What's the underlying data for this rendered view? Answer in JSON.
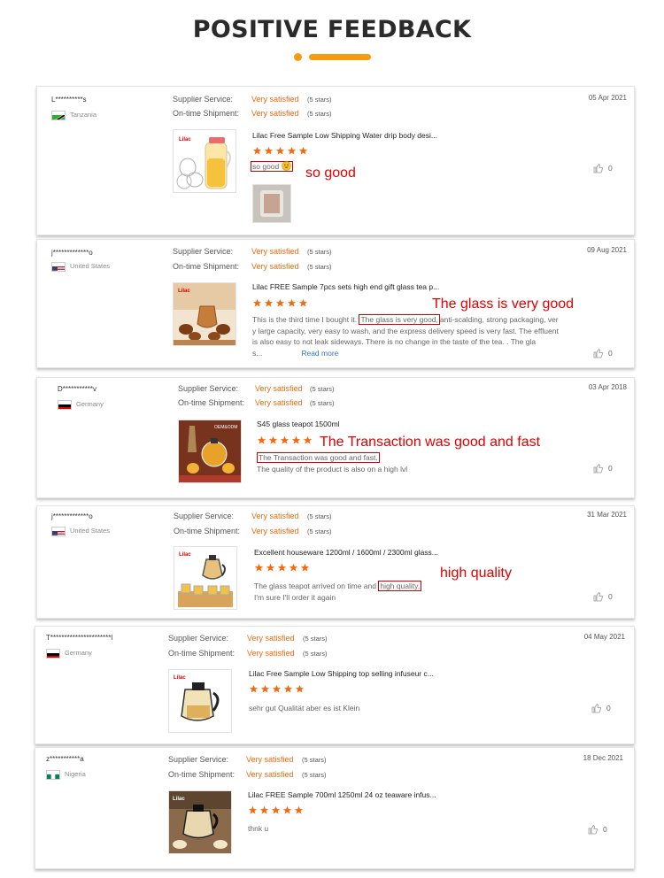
{
  "header": {
    "title": "POSITIVE FEEDBACK"
  },
  "labels": {
    "supplier_service": "Supplier Service:",
    "ontime_shipment": "On-time Shipment:"
  },
  "reviews": [
    {
      "user": "L**********s",
      "country": "Tanzania",
      "date": "05 Apr 2021",
      "supplier_rating": "Very satisfied",
      "supplier_stars": "(5 stars)",
      "shipment_rating": "Very satisfied",
      "shipment_stars": "(5 stars)",
      "product_title": "Lilac Free Sample Low Shipping Water drip body desi...",
      "review_highlight": "so good",
      "annotation": "so good",
      "likes": "0"
    },
    {
      "user": "j*************o",
      "country": "United States",
      "date": "09 Aug 2021",
      "supplier_rating": "Very satisfied",
      "supplier_stars": "(5 stars)",
      "shipment_rating": "Very satisfied",
      "shipment_stars": "(5 stars)",
      "product_title": "Lilac FREE Sample 7pcs sets high end gift glass tea p...",
      "review_before": "This is the third time I bought it.",
      "review_highlight": "The glass is very good,",
      "review_after": "anti-scalding, strong packaging, ver",
      "review_line2": "y large capacity, very easy to wash, and the express delivery speed is very fast. The effluent",
      "review_line3": "is also easy to not leak sideways. There is no change in the taste of the tea. . The gla",
      "review_line4": "s...",
      "read_more": "Read more",
      "annotation": "The glass is very good",
      "likes": "0"
    },
    {
      "user": "D***********v",
      "country": "Germany",
      "date": "03 Apr 2018",
      "supplier_rating": "Very satisfied",
      "supplier_stars": "(5 stars)",
      "shipment_rating": "Very satisfied",
      "shipment_stars": "(5 stars)",
      "product_title": "S45 glass teapot 1500ml",
      "review_highlight": "The Transaction was good and fast.",
      "review_line2": "The quality of the product is also on a high lvl",
      "annotation": "The Transaction was good and fast",
      "likes": "0"
    },
    {
      "user": "j*************o",
      "country": "United States",
      "date": "31 Mar 2021",
      "supplier_rating": "Very satisfied",
      "supplier_stars": "(5 stars)",
      "shipment_rating": "Very satisfied",
      "shipment_stars": "(5 stars)",
      "product_title": "Excellent houseware 1200ml / 1600ml / 2300ml glass...",
      "review_before": "The glass teapot arrived on time and",
      "review_highlight": "high quality.",
      "review_line2": "I'm sure I'll order it again",
      "annotation": "high quality",
      "likes": "0"
    },
    {
      "user": "T**********************l",
      "country": "Germany",
      "date": "04 May 2021",
      "supplier_rating": "Very satisfied",
      "supplier_stars": "(5 stars)",
      "shipment_rating": "Very satisfied",
      "shipment_stars": "(5 stars)",
      "product_title": "Lilac Free Sample Low Shipping top selling infuseur c...",
      "review_text": "sehr gut Qualität aber es ist Klein",
      "likes": "0"
    },
    {
      "user": "z***********a",
      "country": "Nigeria",
      "date": "18 Dec 2021",
      "supplier_rating": "Very satisfied",
      "supplier_stars": "(5 stars)",
      "shipment_rating": "Very satisfied",
      "shipment_stars": "(5 stars)",
      "product_title": "Lilac FREE Sample 700ml 1250ml 24 oz teaware infus...",
      "review_text": "thnk u",
      "likes": "0"
    }
  ],
  "colors": {
    "accent": "#f39c12",
    "rating": "#f26a10",
    "annotation": "#e20000",
    "link": "#2a78c8"
  },
  "icons": {
    "star": "star-icon",
    "like": "thumbs-up-icon",
    "emoji": "smiley-emoji-icon"
  }
}
